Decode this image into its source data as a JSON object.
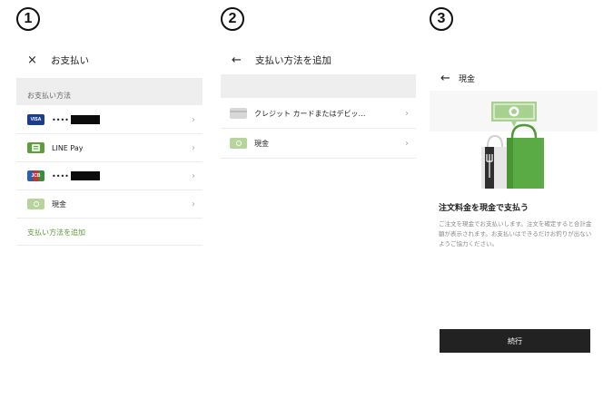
{
  "steps": [
    "1",
    "2",
    "3"
  ],
  "screen1": {
    "close_icon": "×",
    "title": "お支払い",
    "section_label": "お支払い方法",
    "items": [
      {
        "logo": "VISA",
        "logo_color": "#1a3e8c",
        "label": "••••",
        "masked": true
      },
      {
        "logo": "LINE",
        "logo_color": "#5f9e3e",
        "label": "LINE Pay",
        "masked": false
      },
      {
        "logo": "JCB",
        "logo_color": "#3d6fb6",
        "label": "••••",
        "masked": true
      },
      {
        "logo": "cash",
        "logo_color": "#9ec37c",
        "label": "現金",
        "masked": false
      }
    ],
    "add_link": "支払い方法を追加",
    "chevron": "›"
  },
  "screen2": {
    "back_icon": "←",
    "title": "支払い方法を追加",
    "items": [
      {
        "label": "クレジット カードまたはデビッ…"
      },
      {
        "label": "現金"
      }
    ],
    "chevron": "›"
  },
  "screen3": {
    "back_icon": "←",
    "title": "現金",
    "heading": "注文料金を現金で支払う",
    "body": "ご注文を現金でお支払いします。注文を確定すると合計金額が表示されます。お支払いはできるだけお釣りが出ないようご協力ください。",
    "button": "続行"
  },
  "colors": {
    "accent_green": "#5b9a3c",
    "button_dark": "#222222"
  }
}
